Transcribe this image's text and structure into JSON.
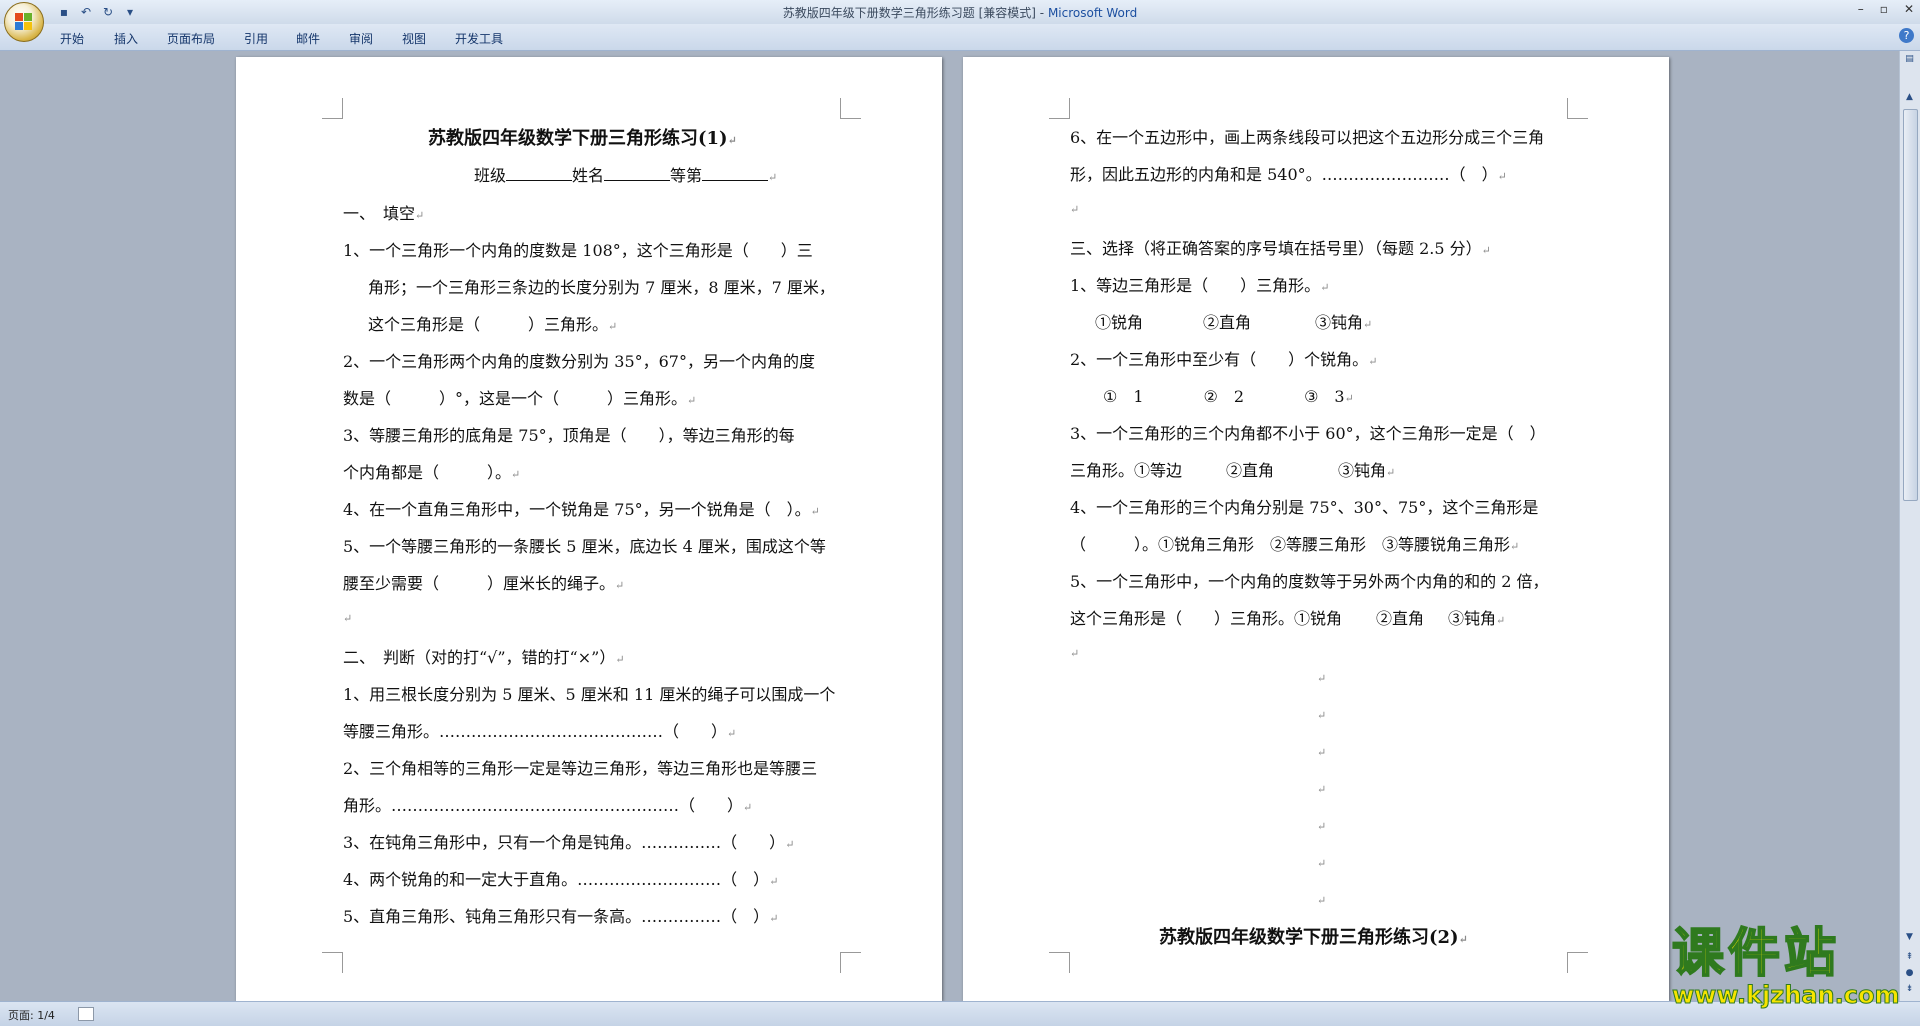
{
  "window": {
    "title": "苏教版四年级下册数学三角形练习题 [兼容模式]",
    "app_name": "Microsoft Word"
  },
  "quick_access": {
    "icons": [
      "save-icon",
      "undo-icon",
      "redo-icon",
      "customize-icon"
    ]
  },
  "ribbon_tabs": [
    "开始",
    "插入",
    "页面布局",
    "引用",
    "邮件",
    "审阅",
    "视图",
    "开发工具"
  ],
  "status": {
    "page": "页面: 1/4"
  },
  "left_page": {
    "title": "苏教版四年级数学下册三角形练习(1)",
    "header_fields": {
      "class": "班级",
      "name": "姓名",
      "grade": "等第"
    },
    "section1": "一、　填空",
    "q1": [
      "1、一个三角形一个内角的度数是 108°，这个三角形是（　　）三",
      "角形；一个三角形三条边的长度分别为 7 厘米，8 厘米，7 厘米，",
      "这个三角形是（　　　）三角形。"
    ],
    "q2": [
      "2、一个三角形两个内角的度数分别为 35°，67°，另一个内角的度",
      "数是（　　　）°，这是一个（　　　）三角形。"
    ],
    "q3": [
      "3、等腰三角形的底角是 75°，顶角是（　　），等边三角形的每",
      "个内角都是（　　　）。"
    ],
    "q4": [
      "4、在一个直角三角形中，一个锐角是 75°，另一个锐角是（　）。"
    ],
    "q5": [
      "5、一个等腰三角形的一条腰长 5 厘米，底边长 4 厘米，围成这个等",
      "腰至少需要（　　　）厘米长的绳子。"
    ],
    "section2": "二、　判断（对的打“√”，错的打“×”）",
    "j1": [
      "1、用三根长度分别为 5 厘米、5 厘米和 11 厘米的绳子可以围成一个",
      "等腰三角形。……………………………………（　　）"
    ],
    "j2": [
      "2、三个角相等的三角形一定是等边三角形，等边三角形也是等腰三",
      "角形。………………………………………………（　　）"
    ],
    "j3": "3、在钝角三角形中，只有一个角是钝角。……………（　　）",
    "j4": "4、两个锐角的和一定大于直角。………………………（　）",
    "j5": "5、直角三角形、钝角三角形只有一条高。……………（　）"
  },
  "right_page": {
    "j6": [
      "6、在一个五边形中，画上两条线段可以把这个五边形分成三个三角",
      "形，因此五边形的内角和是 540°。……………………（　）"
    ],
    "section3": "三、选择（将正确答案的序号填在括号里）（每题 2.5 分）",
    "c1": "1、等边三角形是（　　）三角形。",
    "c1_opts": [
      "①锐角",
      "②直角",
      "③钝角"
    ],
    "c2": "2、一个三角形中至少有（　　）个锐角。",
    "c2_opts": [
      "①　1",
      "②　2",
      "③　3"
    ],
    "c3": [
      "3、一个三角形的三个内角都不小于 60°，这个三角形一定是（　）",
      "三角形。①等边",
      "②直角",
      "③钝角"
    ],
    "c4": [
      "4、一个三角形的三个内角分别是 75°、30°、75°，这个三角形是",
      "（　　　）。①锐角三角形　②等腰三角形　③等腰锐角三角形"
    ],
    "c5": [
      "5、一个三角形中，一个内角的度数等于另外两个内角的和的 2 倍，",
      "这个三角形是（　　）三角形。①锐角",
      "②直角",
      "③钝角"
    ],
    "title2": "苏教版四年级数学下册三角形练习(2)"
  },
  "watermark": {
    "big": "课件站",
    "small": "www.kjzhan.com"
  }
}
